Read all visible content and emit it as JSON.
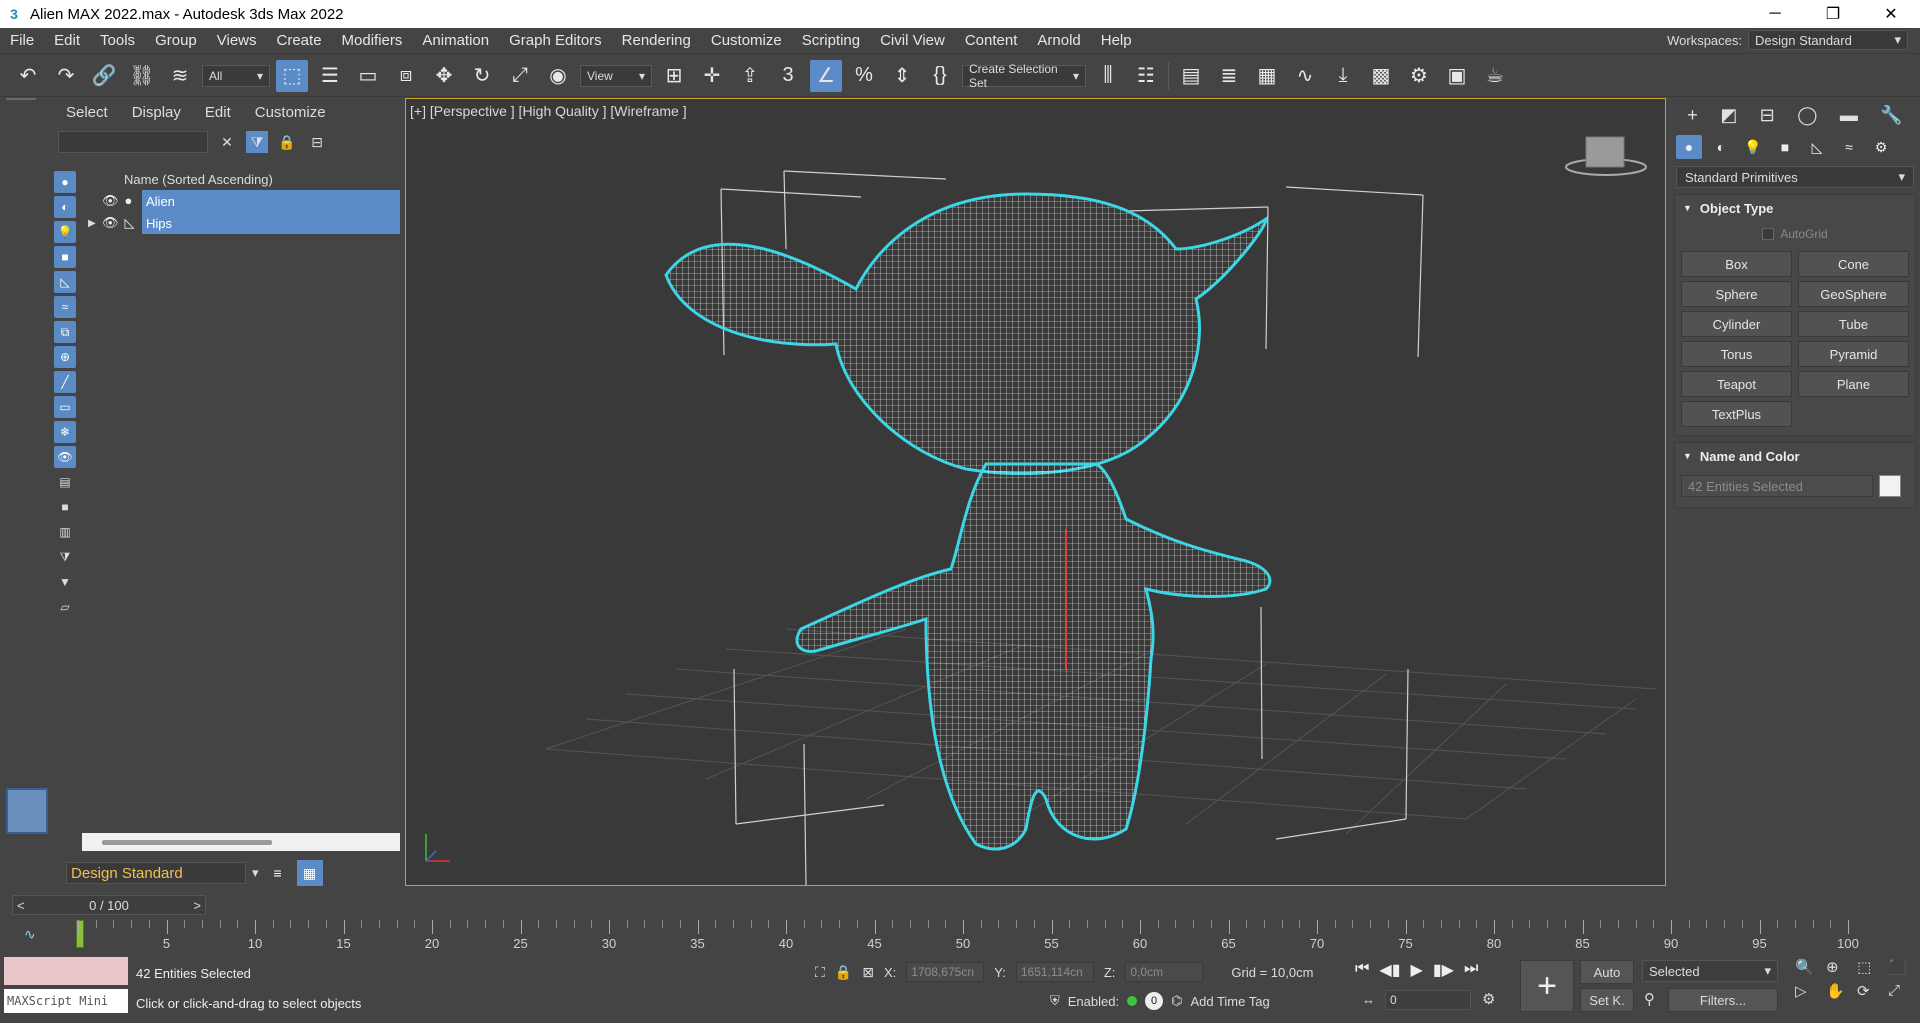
{
  "window": {
    "title": "Alien MAX 2022.max - Autodesk 3ds Max 2022",
    "minimize": "─",
    "maximize": "❐",
    "close": "✕"
  },
  "menu": {
    "items": [
      "File",
      "Edit",
      "Tools",
      "Group",
      "Views",
      "Create",
      "Modifiers",
      "Animation",
      "Graph Editors",
      "Rendering",
      "Customize",
      "Scripting",
      "Civil View",
      "Content",
      "Arnold",
      "Help"
    ],
    "workspaces_label": "Workspaces:",
    "workspace_value": "Design Standard"
  },
  "toolbar": {
    "selection_filter": "All",
    "ref_coord": "View",
    "selection_set": "Create Selection Set"
  },
  "explorer": {
    "tabs": [
      "Select",
      "Display",
      "Edit",
      "Customize"
    ],
    "column_header": "Name (Sorted Ascending)",
    "rows": [
      {
        "name": "Alien"
      },
      {
        "name": "Hips"
      }
    ],
    "workspace_name": "Design Standard"
  },
  "viewport": {
    "label": "[+] [Perspective ] [High Quality ] [Wireframe ]",
    "accent": "#c9a227",
    "wire_color": "#ffffff",
    "outline_color": "#3cd6e6"
  },
  "command_panel": {
    "category": "Standard Primitives",
    "object_type_title": "Object Type",
    "autogrid": "AutoGrid",
    "buttons": [
      "Box",
      "Cone",
      "Sphere",
      "GeoSphere",
      "Cylinder",
      "Tube",
      "Torus",
      "Pyramid",
      "Teapot",
      "Plane",
      "TextPlus"
    ],
    "name_color_title": "Name and Color",
    "name_field": "42 Entities Selected"
  },
  "timeline": {
    "frame_display": "0 / 100",
    "prev": "<",
    "next": ">",
    "tick_labels": [
      "5",
      "10",
      "15",
      "20",
      "25",
      "30",
      "35",
      "40",
      "45",
      "50",
      "55",
      "60",
      "65",
      "70",
      "75",
      "80",
      "85",
      "90",
      "95",
      "100"
    ]
  },
  "status": {
    "maxscript": "MAXScript Mini",
    "selection_text": "42 Entities Selected",
    "prompt": "Click or click-and-drag to select objects",
    "x_label": "X:",
    "x_value": "1708,675cn",
    "y_label": "Y:",
    "y_value": "1651,114cn",
    "z_label": "Z:",
    "z_value": "0,0cm",
    "grid": "Grid = 10,0cm",
    "enabled": "Enabled:",
    "add_time_tag": "Add Time Tag",
    "frame_spinner": "0",
    "auto": "Auto",
    "setk": "Set K.",
    "selected": "Selected",
    "filters": "Filters..."
  }
}
